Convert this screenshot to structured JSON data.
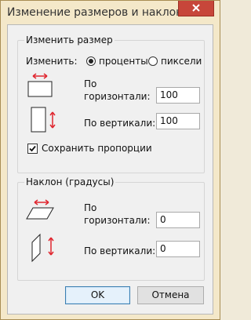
{
  "window": {
    "title": "Изменение размеров и наклона"
  },
  "resize": {
    "group_title": "Изменить размер",
    "by_label": "Изменить:",
    "option_percent": "проценты",
    "option_pixels": "пиксели",
    "selected": "проценты",
    "horizontal_label_line1": "По",
    "horizontal_label_line2": "горизонтали:",
    "horizontal_value": "100",
    "vertical_label": "По вертикали:",
    "vertical_value": "100",
    "keep_ratio_label": "Сохранить пропорции",
    "keep_ratio_checked": true
  },
  "skew": {
    "group_title": "Наклон (градусы)",
    "horizontal_label_line1": "По",
    "horizontal_label_line2": "горизонтали:",
    "horizontal_value": "0",
    "vertical_label": "По вертикали:",
    "vertical_value": "0"
  },
  "buttons": {
    "ok": "OK",
    "cancel": "Отмена"
  },
  "icons": {
    "close": "close-icon",
    "resize_h": "resize-horizontal-icon",
    "resize_v": "resize-vertical-icon",
    "skew_h": "skew-horizontal-icon",
    "skew_v": "skew-vertical-icon",
    "check": "checkmark-icon"
  },
  "colors": {
    "arrow": "#e0262f",
    "title_bar": "#f4e8c9",
    "close": "#c7463a"
  }
}
